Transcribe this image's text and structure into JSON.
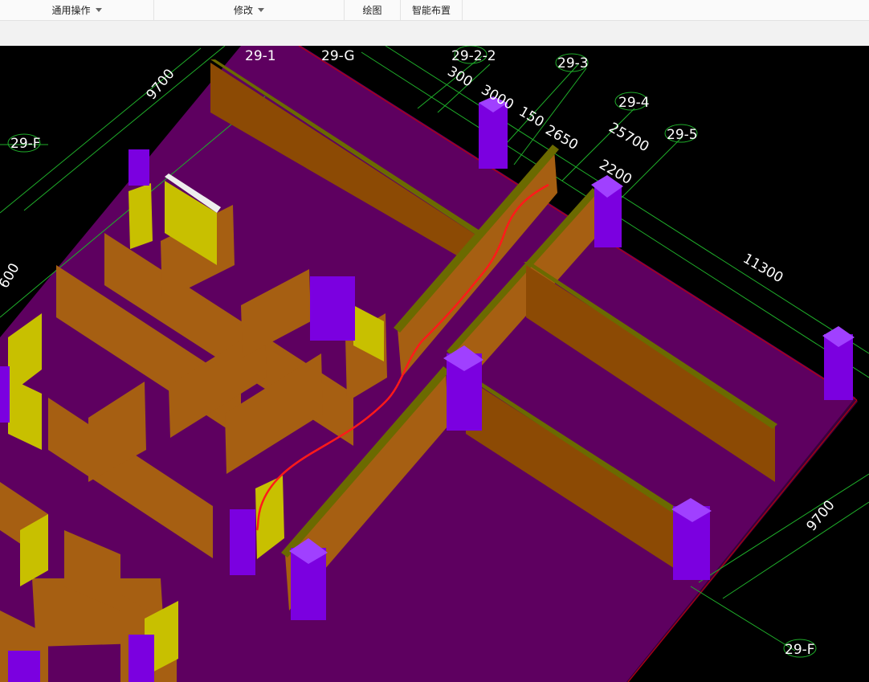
{
  "toolbar": {
    "groups": [
      {
        "label": "通用操作",
        "has_dropdown": true
      },
      {
        "label": "修改",
        "has_dropdown": true
      },
      {
        "label": "绘图",
        "has_dropdown": false
      },
      {
        "label": "智能布置",
        "has_dropdown": false
      }
    ]
  },
  "viewport": {
    "axis_labels": {
      "f_left": "29-F",
      "f_bottom": "29-F",
      "g": "29-G",
      "one": "29-1",
      "two_2": "29-2-2",
      "three": "29-3",
      "four": "29-4",
      "five": "29-5"
    },
    "dimensions": {
      "d_9700_top": "9700",
      "d_300": "300",
      "d_3000": "3000",
      "d_150": "150",
      "d_2650": "2650",
      "d_25700": "25700",
      "d_2200": "2200",
      "d_11300": "11300",
      "d_9700_right": "9700",
      "d_600": "600"
    },
    "colors": {
      "background": "#000000",
      "floor_slab": "#5e0060",
      "wall": "#a65f12",
      "wall_dark": "#7a4308",
      "column": "#7b00e0",
      "window_panel": "#c8c000",
      "axis_grid": "#1fae2a",
      "markup_stroke": "#ff1a1a"
    }
  }
}
